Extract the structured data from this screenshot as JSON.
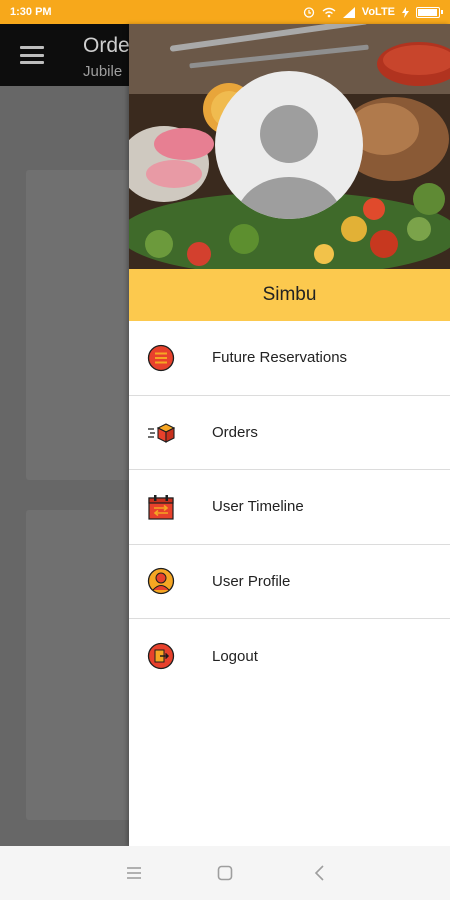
{
  "status_bar": {
    "time": "1:30 PM",
    "network": "VoLTE",
    "battery_level": 0.95
  },
  "app_bar": {
    "title": "Orde",
    "subtitle": "Jubile"
  },
  "drawer": {
    "username": "Simbu",
    "items": [
      {
        "label": "Future Reservations",
        "icon": "reservations-icon"
      },
      {
        "label": "Orders",
        "icon": "orders-box-icon"
      },
      {
        "label": "User Timeline",
        "icon": "timeline-calendar-icon"
      },
      {
        "label": "User Profile",
        "icon": "user-profile-icon"
      },
      {
        "label": "Logout",
        "icon": "logout-icon"
      }
    ]
  },
  "colors": {
    "status_bar": "#f7a81b",
    "user_band": "#fcc94e",
    "icon_red": "#e8412c",
    "icon_orange": "#f6a623"
  }
}
